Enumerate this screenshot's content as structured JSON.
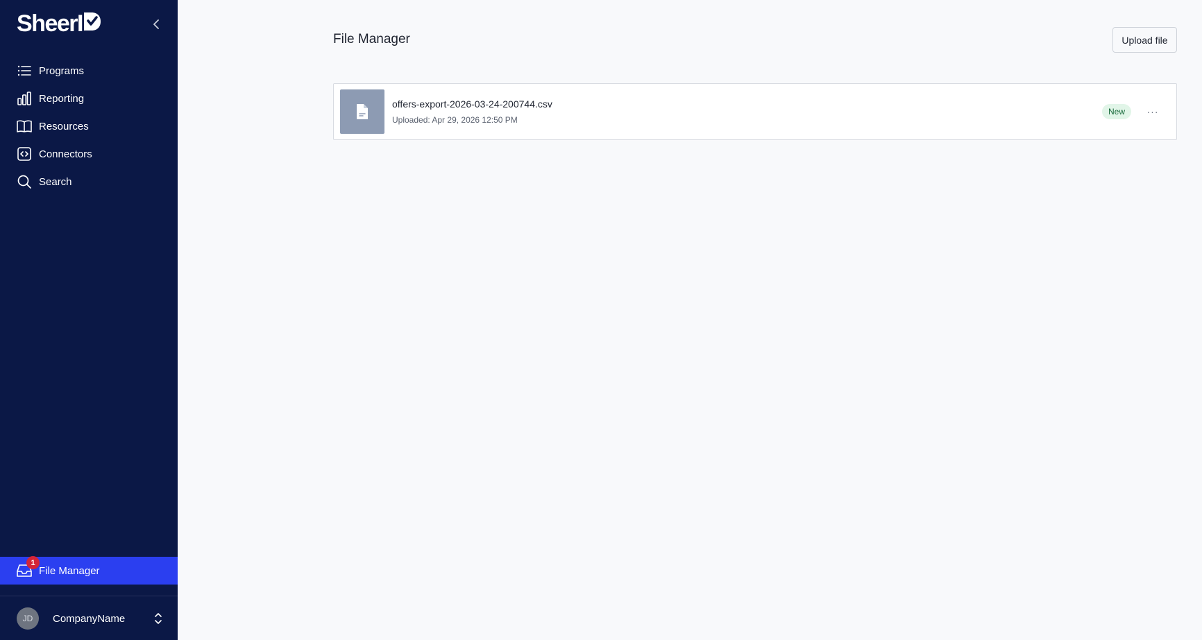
{
  "app": {
    "logo_text": "SheerID"
  },
  "sidebar": {
    "items": [
      {
        "label": "Programs",
        "icon": "list-icon"
      },
      {
        "label": "Reporting",
        "icon": "bar-chart-icon"
      },
      {
        "label": "Resources",
        "icon": "book-icon"
      },
      {
        "label": "Connectors",
        "icon": "code-icon"
      },
      {
        "label": "Search",
        "icon": "search-icon"
      }
    ],
    "file_manager": {
      "label": "File Manager",
      "icon": "inbox-icon",
      "badge_count": "1",
      "active": true
    },
    "account": {
      "initials": "JD",
      "company": "CompanyName"
    }
  },
  "main": {
    "title": "File Manager",
    "upload_label": "Upload file",
    "files": [
      {
        "name": "offers-export-2026-03-24-200744.csv",
        "uploaded": "Uploaded: Apr 29, 2026 12:50 PM",
        "status": "New",
        "more_label": "···"
      }
    ]
  },
  "colors": {
    "sidebar_bg": "#0b1846",
    "active_bg": "#2b3ff0",
    "badge_bg": "#d42437",
    "status_bg": "#e1f5e8",
    "status_text": "#17693a"
  }
}
